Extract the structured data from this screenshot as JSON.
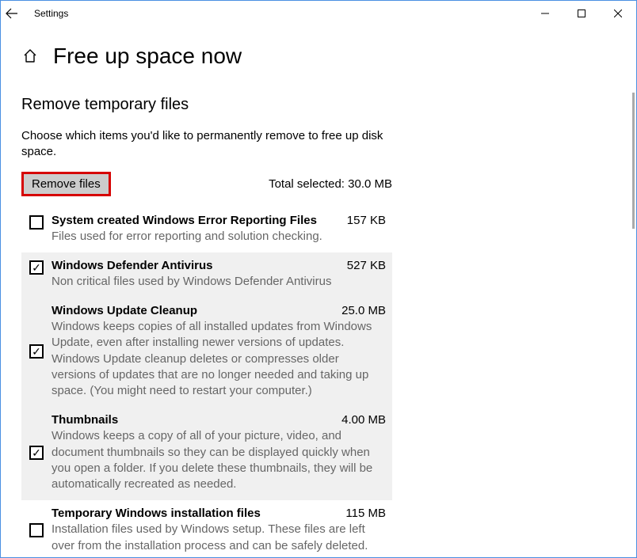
{
  "window": {
    "title": "Settings"
  },
  "page": {
    "title": "Free up space now",
    "section_title": "Remove temporary files",
    "intro": "Choose which items you'd like to permanently remove to free up disk space.",
    "remove_button": "Remove files",
    "total_label": "Total selected: 30.0 MB"
  },
  "items": [
    {
      "title": "System created Windows Error Reporting Files",
      "size": "157 KB",
      "desc": "Files used for error reporting and solution checking.",
      "checked": false,
      "selected": false
    },
    {
      "title": "Windows Defender Antivirus",
      "size": "527 KB",
      "desc": "Non critical files used by Windows Defender Antivirus",
      "checked": true,
      "selected": true
    },
    {
      "title": "Windows Update Cleanup",
      "size": "25.0 MB",
      "desc": "Windows keeps copies of all installed updates from Windows Update, even after installing newer versions of updates. Windows Update cleanup deletes or compresses older versions of updates that are no longer needed and taking up space. (You might need to restart your computer.)",
      "checked": true,
      "selected": true
    },
    {
      "title": "Thumbnails",
      "size": "4.00 MB",
      "desc": "Windows keeps a copy of all of your picture, video, and document thumbnails so they can be displayed quickly when you open a folder. If you delete these thumbnails, they will be automatically recreated as needed.",
      "checked": true,
      "selected": true
    },
    {
      "title": "Temporary Windows installation files",
      "size": "115 MB",
      "desc": "Installation files used by Windows setup.  These files are left over from the installation process and can be safely deleted.",
      "checked": false,
      "selected": false
    }
  ]
}
